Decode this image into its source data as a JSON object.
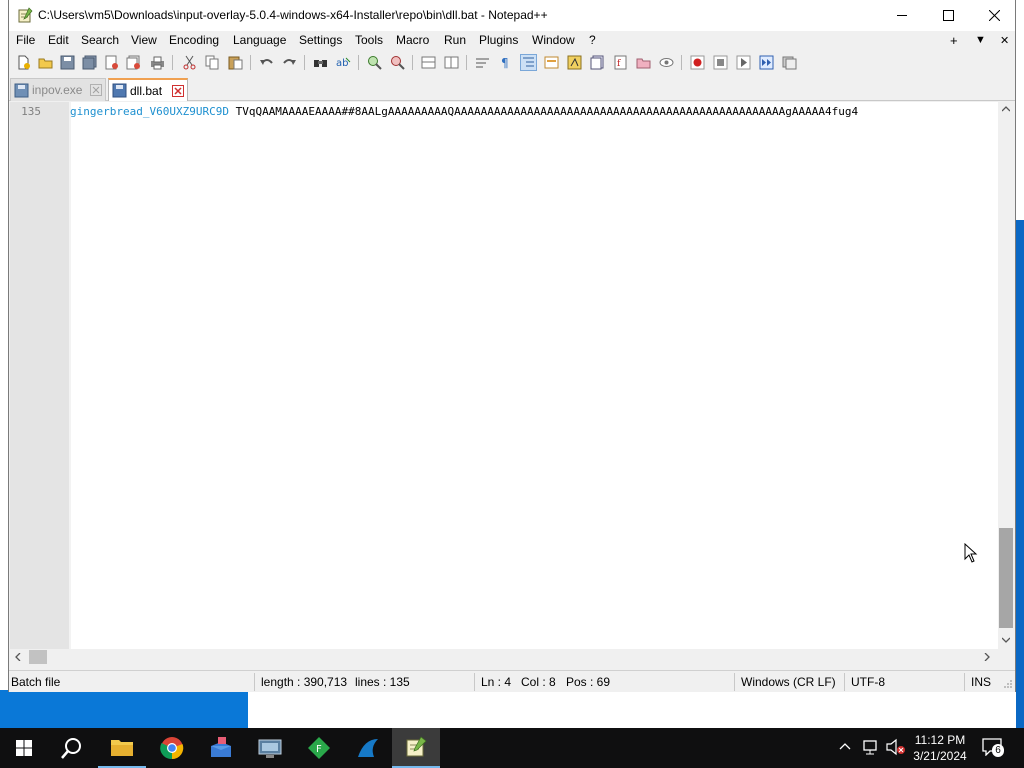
{
  "window": {
    "title": "C:\\Users\\vm5\\Downloads\\input-overlay-5.0.4-windows-x64-Installer\\repo\\bin\\dll.bat - Notepad++"
  },
  "menu": {
    "items": [
      "File",
      "Edit",
      "Search",
      "View",
      "Encoding",
      "Language",
      "Settings",
      "Tools",
      "Macro",
      "Run",
      "Plugins",
      "Window",
      "?"
    ],
    "right": [
      "+",
      "▼",
      "✕"
    ]
  },
  "tabs": [
    {
      "label": "inpov.exe",
      "active": false
    },
    {
      "label": "dll.bat",
      "active": true
    }
  ],
  "editor": {
    "line_number": "135",
    "line_label": "gingerbread_V60UXZ9URC9D",
    "line_content": " TVqQAAMAAAAEAAAA##8AALgAAAAAAAAAQAAAAAAAAAAAAAAAAAAAAAAAAAAAAAAAAAAAAAAAAAAAAAAAAAAgAAAAA4fug4"
  },
  "status": {
    "file_type": "Batch file",
    "length": "length : 390,713",
    "lines": "lines : 135",
    "ln": "Ln : 4",
    "col": "Col : 8",
    "pos": "Pos : 69",
    "eol": "Windows (CR LF)",
    "encoding": "UTF-8",
    "mode": "INS"
  },
  "taskbar": {
    "time": "11:12 PM",
    "date": "3/21/2024",
    "notification_count": "6"
  },
  "colors": {
    "accent_blue": "#0a78d7",
    "code_label": "#1e90d0",
    "tab_active_border": "#f0a050"
  }
}
